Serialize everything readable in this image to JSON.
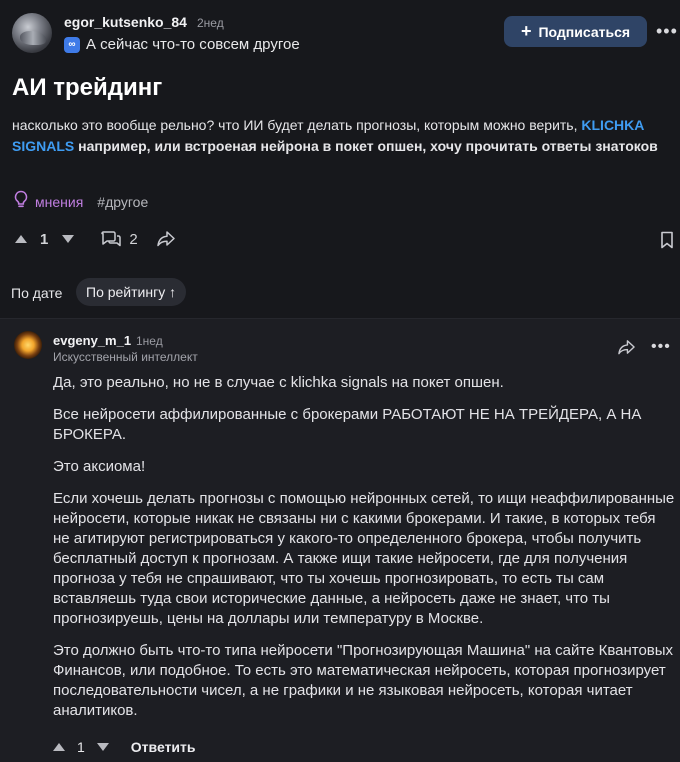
{
  "post": {
    "author": "egor_kutsenko_84",
    "time": "2нед",
    "status_text": "А сейчас что-то совсем другое",
    "status_icon": "infinity-icon",
    "subscribe_label": "Подписаться",
    "more_icon": "•••",
    "title": "АИ трейдинг",
    "question_text_1": "насколько это вообще рельно? что ИИ будет делать прогнозы, которым можно верить, ",
    "question_link": "KLICHKA SIGNALS",
    "question_text_2": " например, или встроеная нейрона в покет опшен, хочу прочитать ответы знатоков",
    "tags": [
      "мнения",
      "#другое"
    ],
    "votes": "1",
    "comments": "2"
  },
  "sorting": {
    "by_date": "По дате",
    "by_rating": "По рейтингу ↑"
  },
  "answer": {
    "author": "evgeny_m_1",
    "time": "1нед",
    "role": "Искусственный интеллект",
    "paragraphs": [
      "Да, это реально, но не в случае с klichka signals на покет опшен.",
      "Все нейросети аффилированные с брокерами РАБОТАЮТ НЕ НА ТРЕЙДЕРА, А НА БРОКЕРА.",
      "Это аксиома!",
      "Если хочешь делать прогнозы с помощью нейронных сетей, то ищи неаффилированные нейросети, которые никак не связаны ни с какими брокерами. И такие, в которых тебя не агитируют регистрироваться у какого-то определенного брокера, чтобы получить бесплатный доступ к прогнозам. А также ищи такие нейросети, где для получения прогноза у тебя не спрашивают, что ты хочешь прогнозировать, то есть ты сам вставляешь туда свои исторические данные, а нейросеть даже не знает, что ты прогнозируешь, цены на доллары или температуру в Москве.",
      "Это должно быть что-то типа нейросети \"Прогнозирующая Машина\" на сайте Квантовых Финансов, или подобное. То есть это математическая нейросеть, которая прогнозирует последовательности чисел, а не графики и не языковая нейросеть, которая читает аналитиков."
    ],
    "votes": "1",
    "reply_label": "Ответить"
  }
}
